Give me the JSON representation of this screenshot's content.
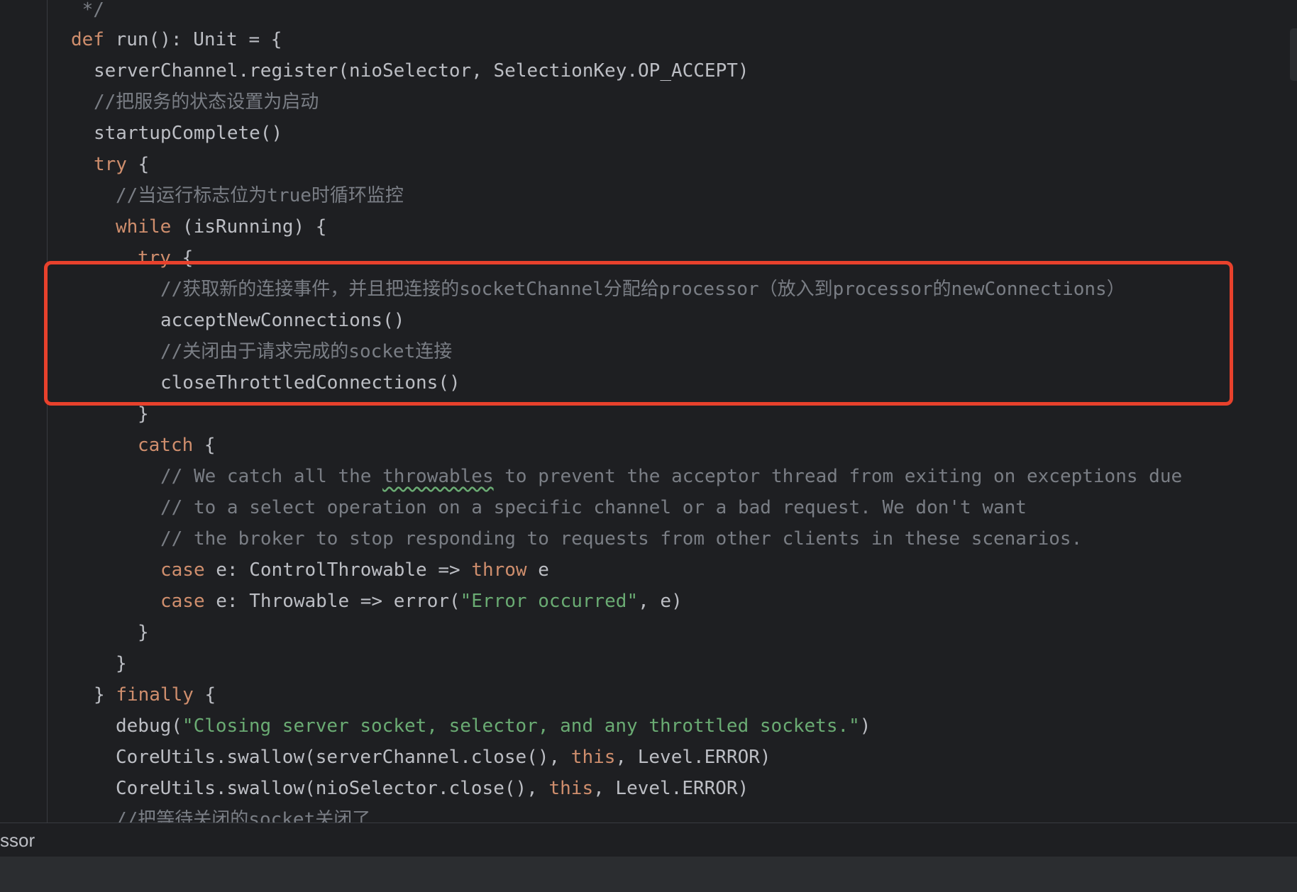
{
  "editor": {
    "lines": [
      {
        "id": "l0",
        "parts": [
          {
            "t": " */",
            "c": "cmt"
          }
        ]
      },
      {
        "id": "l1",
        "parts": [
          {
            "t": "def",
            "c": "kw"
          },
          {
            "t": " run(): Unit = {",
            "c": "plain"
          }
        ]
      },
      {
        "id": "l2",
        "parts": [
          {
            "t": "serverChannel.register(nioSelector, SelectionKey.OP_ACCEPT)",
            "c": "plain"
          }
        ]
      },
      {
        "id": "l3",
        "parts": [
          {
            "t": "//把服务的状态设置为启动",
            "c": "cmt"
          }
        ]
      },
      {
        "id": "l4",
        "parts": [
          {
            "t": "startupComplete()",
            "c": "plain"
          }
        ]
      },
      {
        "id": "l5",
        "parts": [
          {
            "t": "try",
            "c": "kw"
          },
          {
            "t": " {",
            "c": "plain"
          }
        ]
      },
      {
        "id": "l6",
        "parts": [
          {
            "t": "//当运行标志位为true时循环监控",
            "c": "cmt"
          }
        ]
      },
      {
        "id": "l7",
        "parts": [
          {
            "t": "while",
            "c": "kw"
          },
          {
            "t": " (isRunning) {",
            "c": "plain"
          }
        ]
      },
      {
        "id": "l8",
        "parts": [
          {
            "t": "try",
            "c": "kw"
          },
          {
            "t": " {",
            "c": "plain"
          }
        ]
      },
      {
        "id": "l9",
        "parts": [
          {
            "t": "//获取新的连接事件，并且把连接的socketChannel分配给processor（放入到processor的newConnections）",
            "c": "cmt"
          }
        ]
      },
      {
        "id": "l10",
        "parts": [
          {
            "t": "acceptNewConnections()",
            "c": "plain"
          }
        ]
      },
      {
        "id": "l11",
        "parts": [
          {
            "t": "//关闭由于请求完成的socket连接",
            "c": "cmt"
          }
        ]
      },
      {
        "id": "l12",
        "parts": [
          {
            "t": "closeThrottledConnections()",
            "c": "plain"
          }
        ]
      },
      {
        "id": "l13",
        "parts": [
          {
            "t": "}",
            "c": "plain"
          }
        ]
      },
      {
        "id": "l14",
        "parts": [
          {
            "t": "catch",
            "c": "kw"
          },
          {
            "t": " {",
            "c": "plain"
          }
        ]
      },
      {
        "id": "l15",
        "parts": [
          {
            "t": "// We catch all the ",
            "c": "cmt"
          },
          {
            "t": "throwables",
            "c": "cmt typo"
          },
          {
            "t": " to prevent the acceptor thread from exiting on exceptions due",
            "c": "cmt"
          }
        ]
      },
      {
        "id": "l16",
        "parts": [
          {
            "t": "// to a select operation on a specific channel or a bad request. We don't want",
            "c": "cmt"
          }
        ]
      },
      {
        "id": "l17",
        "parts": [
          {
            "t": "// the broker to stop responding to requests from other clients in these scenarios.",
            "c": "cmt"
          }
        ]
      },
      {
        "id": "l18",
        "parts": [
          {
            "t": "case",
            "c": "kw"
          },
          {
            "t": " e: ControlThrowable => ",
            "c": "plain"
          },
          {
            "t": "throw",
            "c": "kw"
          },
          {
            "t": " e",
            "c": "plain"
          }
        ]
      },
      {
        "id": "l19",
        "parts": [
          {
            "t": "case",
            "c": "kw"
          },
          {
            "t": " e: Throwable => error(",
            "c": "plain"
          },
          {
            "t": "\"Error occurred\"",
            "c": "str"
          },
          {
            "t": ", e)",
            "c": "plain"
          }
        ]
      },
      {
        "id": "l20",
        "parts": [
          {
            "t": "}",
            "c": "plain"
          }
        ]
      },
      {
        "id": "l21",
        "parts": [
          {
            "t": "}",
            "c": "plain"
          }
        ]
      },
      {
        "id": "l22",
        "parts": [
          {
            "t": "} ",
            "c": "plain"
          },
          {
            "t": "finally",
            "c": "kw"
          },
          {
            "t": " {",
            "c": "plain"
          }
        ]
      },
      {
        "id": "l23",
        "parts": [
          {
            "t": "debug(",
            "c": "plain"
          },
          {
            "t": "\"Closing server socket, selector, and any throttled sockets.\"",
            "c": "str"
          },
          {
            "t": ")",
            "c": "plain"
          }
        ]
      },
      {
        "id": "l24",
        "parts": [
          {
            "t": "CoreUtils.swallow(serverChannel.close(), ",
            "c": "plain"
          },
          {
            "t": "this",
            "c": "kw"
          },
          {
            "t": ", Level.ERROR)",
            "c": "plain"
          }
        ]
      },
      {
        "id": "l25",
        "parts": [
          {
            "t": "CoreUtils.swallow(nioSelector.close(), ",
            "c": "plain"
          },
          {
            "t": "this",
            "c": "kw"
          },
          {
            "t": ", Level.ERROR)",
            "c": "plain"
          }
        ]
      },
      {
        "id": "l26",
        "parts": [
          {
            "t": "//把等待关闭的socket关闭了",
            "c": "cmt"
          }
        ]
      }
    ]
  },
  "bottom_bar": {
    "label": "ssor"
  },
  "colors": {
    "background": "#1e1f22",
    "keyword": "#cf8e6d",
    "comment": "#7a7e85",
    "string": "#6aab73",
    "text": "#bcbec4",
    "highlight_border": "#e8412c"
  }
}
